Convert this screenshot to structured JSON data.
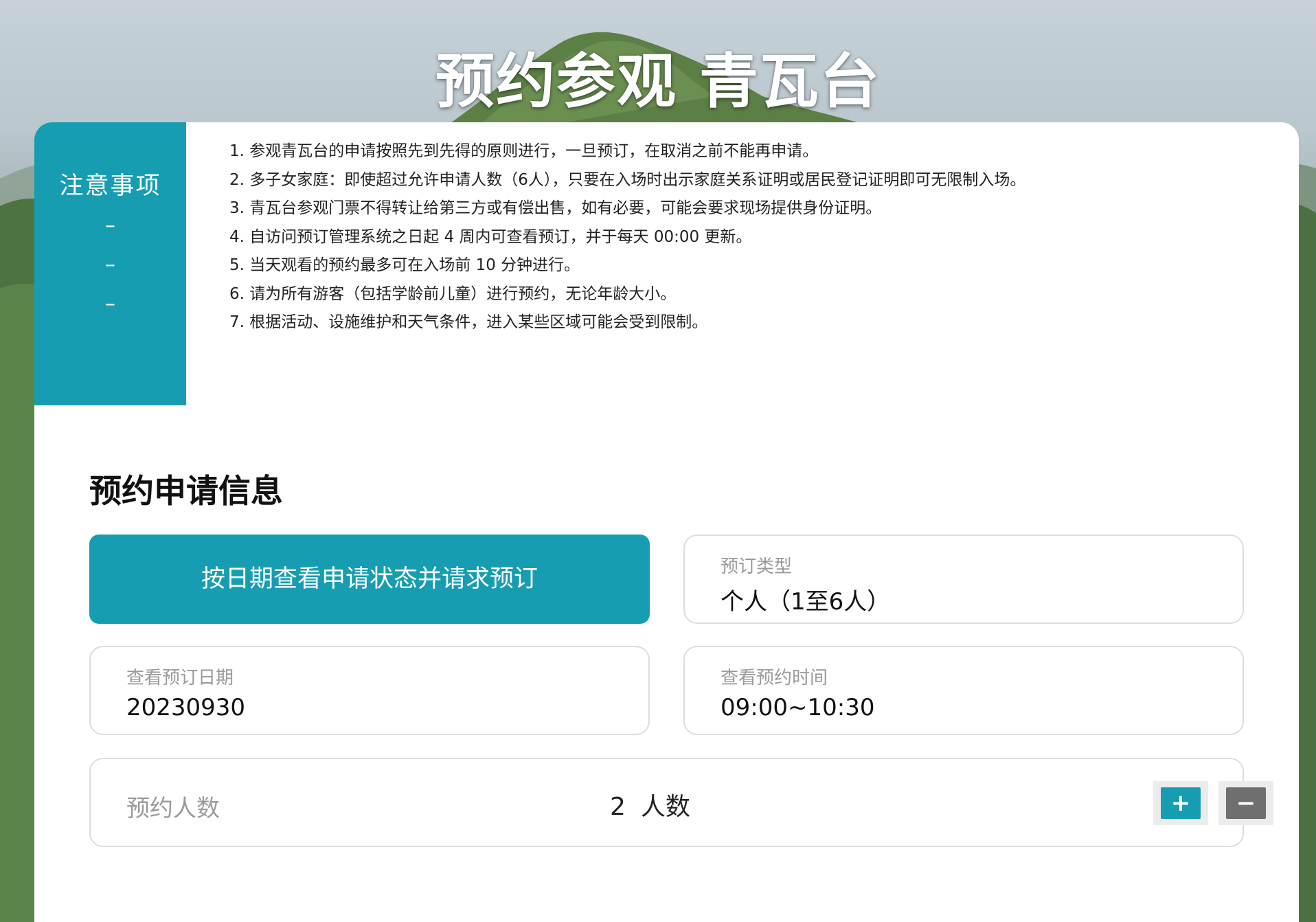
{
  "page": {
    "title": "预约参观 青瓦台"
  },
  "notice": {
    "title": "注意事项",
    "dashes": [
      "–",
      "–",
      "–"
    ],
    "items": [
      "1. 参观青瓦台的申请按照先到先得的原则进行，一旦预订，在取消之前不能再申请。",
      "2. 多子女家庭：即使超过允许申请人数（6人），只要在入场时出示家庭关系证明或居民登记证明即可无限制入场。",
      "3. 青瓦台参观门票不得转让给第三方或有偿出售，如有必要，可能会要求现场提供身份证明。",
      "4. 自访问预订管理系统之日起 4 周内可查看预订，并于每天 00:00 更新。",
      "5. 当天观看的预约最多可在入场前 10 分钟进行。",
      "6. 请为所有游客（包括学龄前儿童）进行预约，无论年龄大小。",
      "7. 根据活动、设施维护和天气条件，进入某些区域可能会受到限制。"
    ]
  },
  "form": {
    "section_title": "预约申请信息",
    "check_button_label": "按日期查看申请状态并请求预订",
    "booking_type": {
      "label": "预订类型",
      "value": "个人（1至6人）"
    },
    "booking_date": {
      "label": "查看预订日期",
      "value": "20230930"
    },
    "booking_time": {
      "label": "查看预约时间",
      "value": "09:00~10:30"
    },
    "people": {
      "label": "预约人数",
      "count": "2",
      "unit": "人数",
      "plus": "+",
      "minus": "−"
    }
  },
  "colors": {
    "accent": "#169db2",
    "minus_button": "#6f6f6f",
    "border": "#dddddd"
  },
  "icons": {
    "plus": "plus-icon",
    "minus": "minus-icon"
  }
}
